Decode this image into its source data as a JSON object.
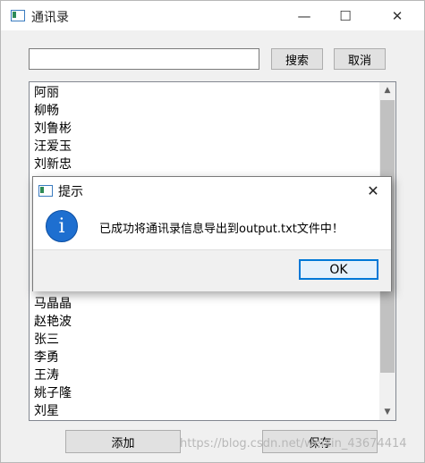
{
  "window": {
    "title": "通讯录",
    "minimize": "—",
    "maximize": "☐",
    "close": "✕"
  },
  "search": {
    "value": "",
    "placeholder": "",
    "search_label": "搜索",
    "cancel_label": "取消"
  },
  "contacts_top": [
    "阿丽",
    "柳畅",
    "刘鲁彬",
    "汪爱玉",
    "刘新忠"
  ],
  "contacts_bottom": [
    "马晶晶",
    "赵艳波",
    "张三",
    "李勇",
    "王涛",
    "姚子隆",
    "刘星"
  ],
  "scrollbar": {
    "up": "▲",
    "down": "▼"
  },
  "buttons": {
    "add_label": "添加",
    "save_label": "保存"
  },
  "dialog": {
    "title": "提示",
    "close": "✕",
    "icon": "information-icon",
    "icon_glyph": "i",
    "message": "已成功将通讯录信息导出到output.txt文件中！",
    "ok_label": "OK",
    "ok_accent": "#0078d7"
  },
  "watermark": "https://blog.csdn.net/weixin_43674414"
}
